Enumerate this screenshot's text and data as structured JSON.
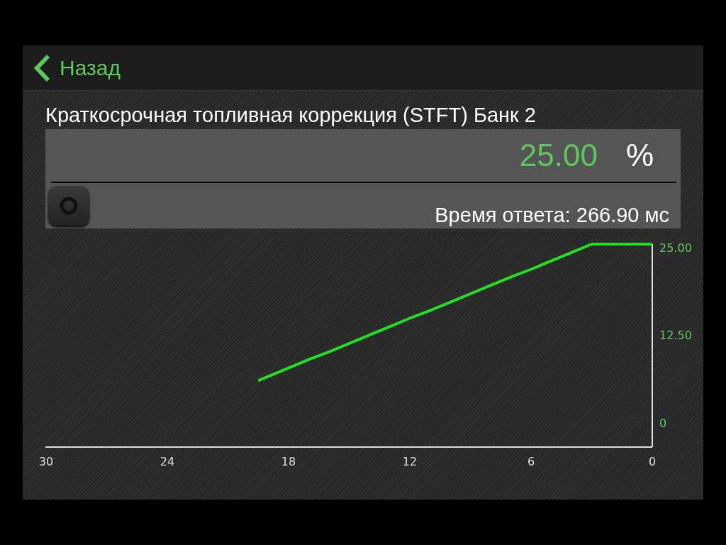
{
  "nav_bar": {
    "back_label": "Назад"
  },
  "title": "Краткосрочная топливная коррекция (STFT) Банк 2",
  "reading": {
    "value": "25.00",
    "unit": "%",
    "response_time": "Время ответа: 266.90 мс"
  },
  "chart_data": {
    "type": "line",
    "xlim": [
      30,
      0
    ],
    "ylim": [
      -4,
      25
    ],
    "xticks": [
      30,
      24,
      18,
      12,
      6,
      0
    ],
    "yticks": [
      {
        "value": 0,
        "label": "0"
      },
      {
        "value": 12.5,
        "label": "12.50"
      },
      {
        "value": 25,
        "label": "25.00"
      }
    ],
    "x": [
      19.5,
      19,
      18,
      17,
      16,
      15,
      14,
      13,
      12,
      11,
      10,
      9,
      8,
      7,
      6,
      5,
      4,
      3,
      2,
      1,
      0
    ],
    "series": [
      {
        "color": "#22dd22",
        "values": [
          5.5,
          6.1,
          7.3,
          8.5,
          9.6,
          10.8,
          12.0,
          13.2,
          14.4,
          15.5,
          16.7,
          17.9,
          19.1,
          20.3,
          21.4,
          22.6,
          23.8,
          25,
          25,
          25,
          25
        ]
      }
    ]
  }
}
